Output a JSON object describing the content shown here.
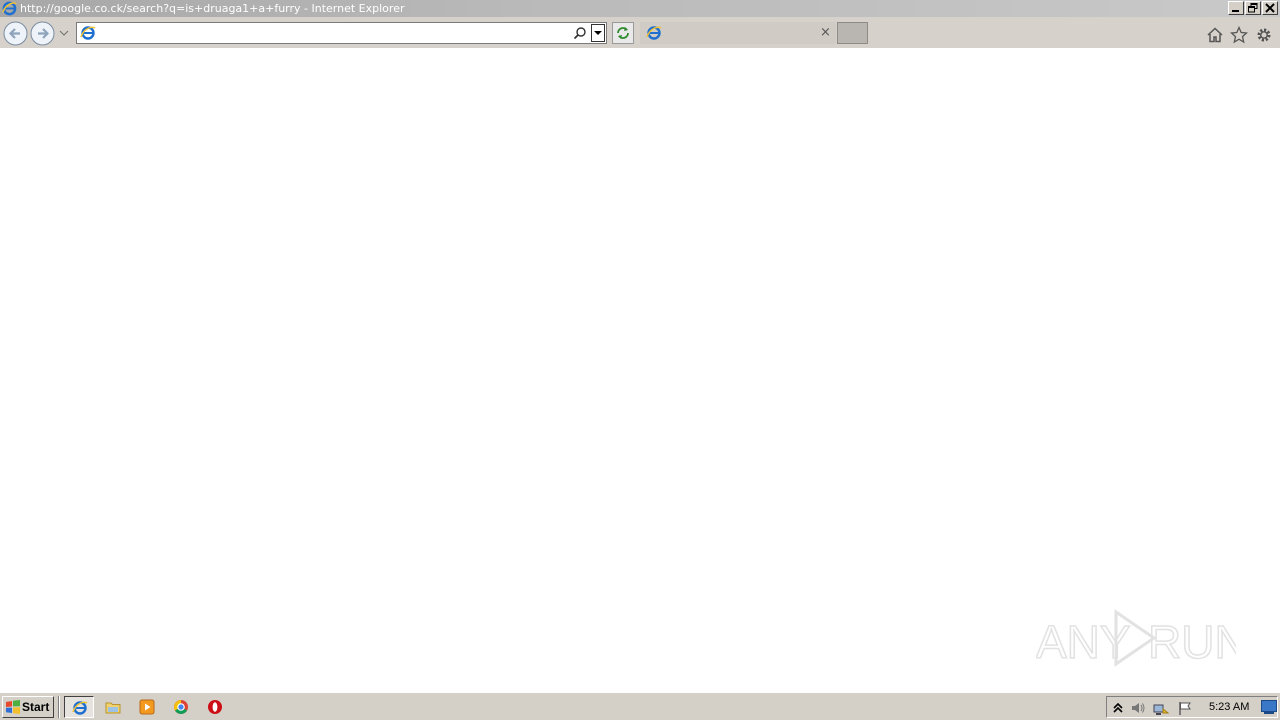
{
  "window": {
    "title": "http://google.co.ck/search?q=is+druaga1+a+furry - Internet Explorer"
  },
  "toolbar": {
    "address_value": "",
    "tab_title": "",
    "tab_close": "×"
  },
  "watermark": {
    "text_left": "ANY",
    "text_right": "RUN"
  },
  "taskbar": {
    "start_label": "Start",
    "apps": [
      "internet-explorer",
      "file-explorer",
      "media-player",
      "chrome",
      "opera"
    ],
    "tray_icons": [
      "show-hidden-icons",
      "volume",
      "network",
      "action-center-flag"
    ],
    "clock": "5:23 AM"
  },
  "colors": {
    "titlebar": "#b3b3b3",
    "toolbar": "#d6d2cb",
    "taskbar": "#d4d0c8",
    "ie_blue": "#1e6fd0",
    "ie_yellow": "#f1c232"
  }
}
